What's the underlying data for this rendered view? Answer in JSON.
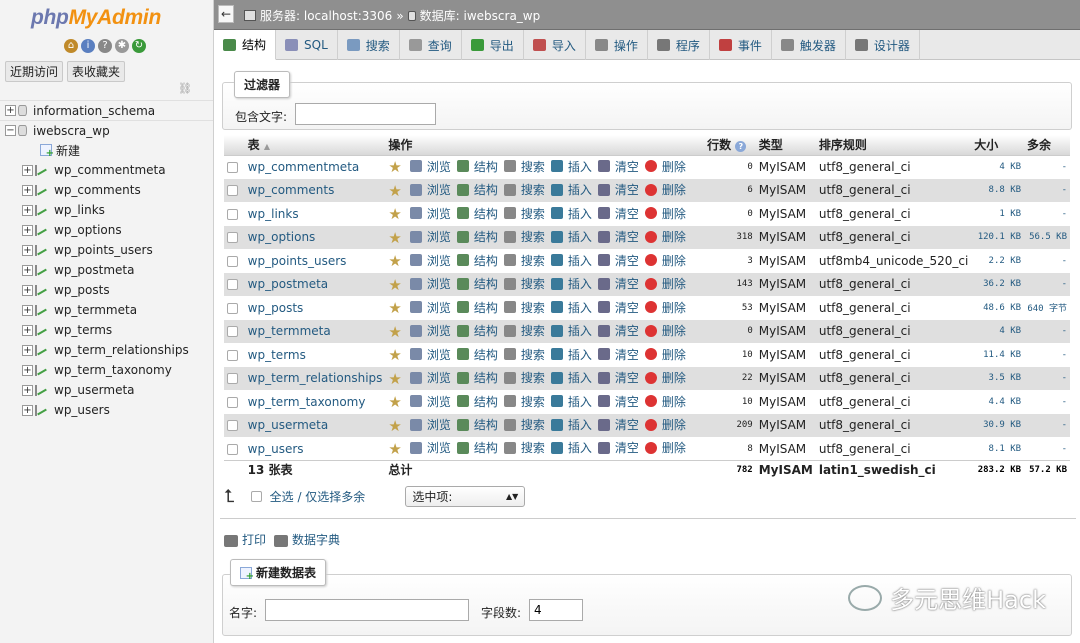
{
  "nav": {
    "logo_php": "php",
    "logo_myadmin": "MyAdmin",
    "recent_label": "近期访问",
    "favorites_label": "表收藏夹",
    "databases": [
      {
        "name": "information_schema",
        "expanded": false
      },
      {
        "name": "iwebscra_wp",
        "expanded": true
      }
    ],
    "new_label": "新建",
    "tables": [
      "wp_commentmeta",
      "wp_comments",
      "wp_links",
      "wp_options",
      "wp_points_users",
      "wp_postmeta",
      "wp_posts",
      "wp_termmeta",
      "wp_terms",
      "wp_term_relationships",
      "wp_term_taxonomy",
      "wp_usermeta",
      "wp_users"
    ]
  },
  "topbar": {
    "back": "←",
    "server_label": "服务器: localhost:3306",
    "sep": "»",
    "db_label": "数据库: iwebscra_wp"
  },
  "tabs": [
    {
      "label": "结构",
      "icon": "structure-icon",
      "active": true
    },
    {
      "label": "SQL",
      "icon": "sql-icon",
      "active": false
    },
    {
      "label": "搜索",
      "icon": "search-icon",
      "active": false
    },
    {
      "label": "查询",
      "icon": "query-icon",
      "active": false
    },
    {
      "label": "导出",
      "icon": "export-icon",
      "active": false
    },
    {
      "label": "导入",
      "icon": "import-icon",
      "active": false
    },
    {
      "label": "操作",
      "icon": "wrench-icon",
      "active": false
    },
    {
      "label": "程序",
      "icon": "routines-icon",
      "active": false
    },
    {
      "label": "事件",
      "icon": "clock-icon",
      "active": false
    },
    {
      "label": "触发器",
      "icon": "trigger-icon",
      "active": false
    },
    {
      "label": "设计器",
      "icon": "designer-icon",
      "active": false
    }
  ],
  "filter": {
    "legend": "过滤器",
    "label": "包含文字:",
    "value": ""
  },
  "table": {
    "headers": {
      "table": "表",
      "sort": "▲",
      "action": "操作",
      "rows": "行数",
      "type": "类型",
      "collation": "排序规则",
      "size": "大小",
      "overhead": "多余"
    },
    "actions": [
      "浏览",
      "结构",
      "搜索",
      "插入",
      "清空",
      "删除"
    ],
    "rows": [
      {
        "name": "wp_commentmeta",
        "rows": "0",
        "type": "MyISAM",
        "collation": "utf8_general_ci",
        "size": "4 KB",
        "overhead": "-"
      },
      {
        "name": "wp_comments",
        "rows": "6",
        "type": "MyISAM",
        "collation": "utf8_general_ci",
        "size": "8.8 KB",
        "overhead": "-"
      },
      {
        "name": "wp_links",
        "rows": "0",
        "type": "MyISAM",
        "collation": "utf8_general_ci",
        "size": "1 KB",
        "overhead": "-"
      },
      {
        "name": "wp_options",
        "rows": "318",
        "type": "MyISAM",
        "collation": "utf8_general_ci",
        "size": "120.1 KB",
        "overhead": "56.5 KB"
      },
      {
        "name": "wp_points_users",
        "rows": "3",
        "type": "MyISAM",
        "collation": "utf8mb4_unicode_520_ci",
        "size": "2.2 KB",
        "overhead": "-"
      },
      {
        "name": "wp_postmeta",
        "rows": "143",
        "type": "MyISAM",
        "collation": "utf8_general_ci",
        "size": "36.2 KB",
        "overhead": "-"
      },
      {
        "name": "wp_posts",
        "rows": "53",
        "type": "MyISAM",
        "collation": "utf8_general_ci",
        "size": "48.6 KB",
        "overhead": "640 字节"
      },
      {
        "name": "wp_termmeta",
        "rows": "0",
        "type": "MyISAM",
        "collation": "utf8_general_ci",
        "size": "4 KB",
        "overhead": "-"
      },
      {
        "name": "wp_terms",
        "rows": "10",
        "type": "MyISAM",
        "collation": "utf8_general_ci",
        "size": "11.4 KB",
        "overhead": "-"
      },
      {
        "name": "wp_term_relationships",
        "rows": "22",
        "type": "MyISAM",
        "collation": "utf8_general_ci",
        "size": "3.5 KB",
        "overhead": "-"
      },
      {
        "name": "wp_term_taxonomy",
        "rows": "10",
        "type": "MyISAM",
        "collation": "utf8_general_ci",
        "size": "4.4 KB",
        "overhead": "-"
      },
      {
        "name": "wp_usermeta",
        "rows": "209",
        "type": "MyISAM",
        "collation": "utf8_general_ci",
        "size": "30.9 KB",
        "overhead": "-"
      },
      {
        "name": "wp_users",
        "rows": "8",
        "type": "MyISAM",
        "collation": "utf8_general_ci",
        "size": "8.1 KB",
        "overhead": "-"
      }
    ],
    "total": {
      "count": "13 张表",
      "label": "总计",
      "rows": "782",
      "type": "MyISAM",
      "collation": "latin1_swedish_ci",
      "size": "283.2 KB",
      "overhead": "57.2 KB"
    }
  },
  "bottom": {
    "select_all": "全选 / 仅选择多余",
    "with_selected": "选中项:"
  },
  "links": {
    "print": "打印",
    "dictionary": "数据字典"
  },
  "create": {
    "legend": "新建数据表",
    "name_label": "名字:",
    "name_value": "",
    "fields_label": "字段数:",
    "fields_value": "4"
  },
  "watermark": "多元思维Hack",
  "colors": {
    "link": "#235a81",
    "topbar": "#8f8f8f",
    "row_even": "#dfdfdf",
    "logo_php": "#6c78af",
    "logo_myadmin": "#f29111"
  }
}
